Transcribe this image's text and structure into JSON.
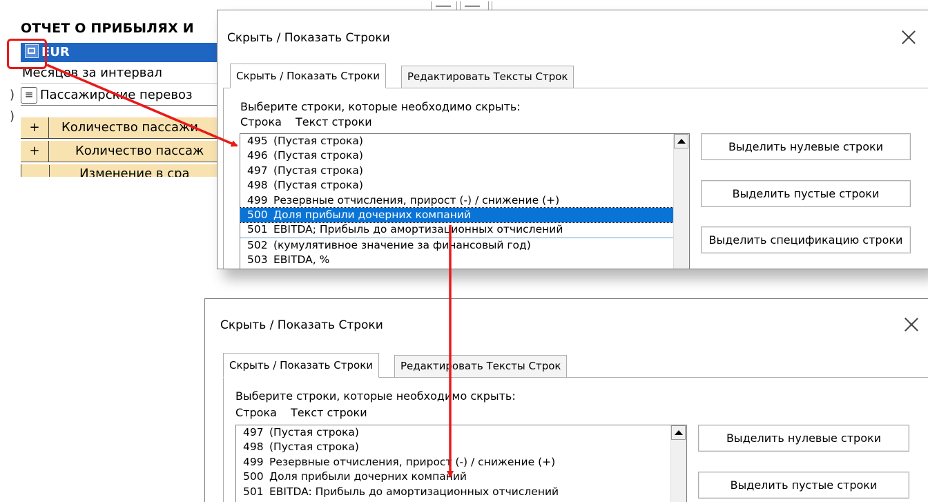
{
  "sheet": {
    "title": "ОТЧЕТ О ПРИБЫЛЯХ И",
    "currency": "EUR",
    "months_label": "Месяцев за интервал",
    "passenger_label": "Пассажирские перевоз",
    "passenger_menu_glyph": "≡",
    "count_label_1": "Количество пассажи",
    "count_label_2": "Количество пассаж",
    "change_label": "Изменение в сра",
    "plus_glyph": "+",
    "paren_glyph": ")"
  },
  "dialog_top": {
    "title": "Скрыть / Показать Строки",
    "tabs": [
      {
        "label": "Скрыть / Показать Строки",
        "active": true
      },
      {
        "label": "Редактировать Тексты Строк",
        "active": false
      }
    ],
    "prompt": "Выберите строки, которые необходимо скрыть:",
    "col_row": "Строка",
    "col_text": "Текст строки",
    "rows": [
      {
        "num": "495",
        "text": "(Пустая строка)"
      },
      {
        "num": "496",
        "text": "(Пустая строка)"
      },
      {
        "num": "497",
        "text": "(Пустая строка)"
      },
      {
        "num": "498",
        "text": "(Пустая строка)"
      },
      {
        "num": "499",
        "text": "Резервные отчисления, прирост (-) / снижение (+)"
      },
      {
        "num": "500",
        "text": "Доля прибыли дочерних компаний",
        "selected": true
      },
      {
        "num": "501",
        "text": "EBITDA; Прибыль до амортизационных отчислений"
      },
      {
        "num": "502",
        "text": "(кумулятивное значение за финансовый год)"
      },
      {
        "num": "503",
        "text": "EBITDA, %"
      }
    ],
    "buttons": [
      "Выделить нулевые строки",
      "Выделить пустые строки",
      "Выделить спецификацию строки"
    ]
  },
  "dialog_bottom": {
    "title": "Скрыть / Показать Строки",
    "tabs": [
      {
        "label": "Скрыть / Показать Строки",
        "active": true
      },
      {
        "label": "Редактировать Тексты Строк",
        "active": false
      }
    ],
    "prompt": "Выберите строки, которые необходимо скрыть:",
    "col_row": "Строка",
    "col_text": "Текст строки",
    "rows": [
      {
        "num": "497",
        "text": "(Пустая строка)"
      },
      {
        "num": "498",
        "text": "(Пустая строка)"
      },
      {
        "num": "499",
        "text": "Резервные отчисления, прирост (-) / снижение (+)"
      },
      {
        "num": "500",
        "text": "Доля прибыли дочерних компаний"
      },
      {
        "num": "501",
        "text": "EBITDA: Прибыль до амортизационных отчислений"
      }
    ],
    "buttons": [
      "Выделить нулевые строки",
      "Выделить пустые строки"
    ]
  },
  "colors": {
    "selection": "#0a74d6",
    "annotation": "#e81a1a",
    "sheet_header": "#1f65c2",
    "sheet_rows": "#f8e3b0"
  }
}
